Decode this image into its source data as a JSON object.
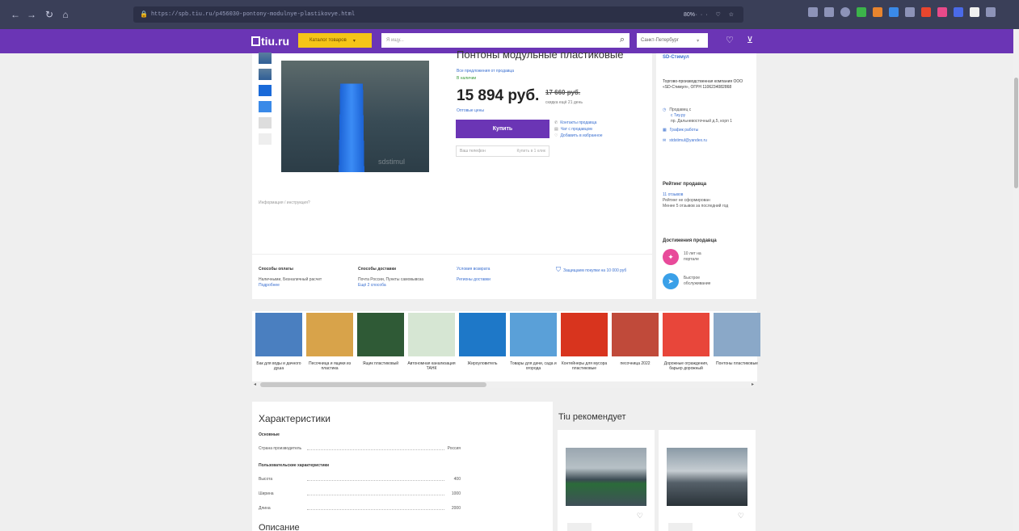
{
  "browser": {
    "url": "https://spb.tiu.ru/p456030-pontony-modulnye-plastikovye.html",
    "zoom": "80%",
    "url_actions": "··· ♡ ☆"
  },
  "header": {
    "logo": "tiu.ru",
    "catalog": "Каталог товаров",
    "search_placeholder": "Я ищу...",
    "city": "Санкт-Петербург"
  },
  "product": {
    "title": "Понтоны модульные пластиковые",
    "all_offers": "Все предложения от продавца",
    "availability": "В наличии",
    "price": "15 894 руб.",
    "old_price": "17 660 руб.",
    "old_note": "скидка ещё 21 день",
    "reviews_link": "Оптовые цены",
    "buy": "Купить",
    "phone_placeholder": "Ваш телефон",
    "callback": "Купить в 1 клик",
    "contact_seller": "Контакты продавца",
    "chat": "Чат с продавцом",
    "favorite": "Добавить в избранное",
    "instructions": "Информация / инструкция?"
  },
  "seller": {
    "name": "SD-Стимул",
    "desc": "Торгово-производственная компания ООО «SD-Стимул», ОГРН 1106234082868",
    "since_label": "Продавец с",
    "since_year": "с Тиу.ру",
    "address": "пр. Дальневосточный д.5, корп 1",
    "schedule": "График работы",
    "email": "stdstimul@yandex.ru",
    "rating_title": "Рейтинг продавца",
    "rating_link": "11 отзывов",
    "rating_line1": "Рейтинг не сформирован",
    "rating_line2": "Менее 5 отзывов за последний год",
    "ach_title": "Достижения продавца",
    "ach1": "10 лет на портале",
    "ach2": "Быстрое обслуживание"
  },
  "info_strip": {
    "payment_h": "Способы оплаты",
    "payment_text": "Наличными, Безналичный расчет",
    "payment_more": "Подробнее",
    "delivery_h": "Способы доставки",
    "delivery_text": "Почта России, Пункты самовывоза",
    "delivery_more": "Ещё 2 способа",
    "terms": "Условия возврата",
    "regions": "Регионы доставки",
    "protect": "Защищаем покупки на 10 000 руб"
  },
  "carousel": [
    {
      "label": "Бак для воды и дачного душа",
      "color": "#4a7fc0"
    },
    {
      "label": "Песочница и ящики из пластика",
      "color": "#d8a34a"
    },
    {
      "label": "Ящик пластиковый",
      "color": "#2f5a36"
    },
    {
      "label": "Автономная канализация ТАНК",
      "color": "#d6e6d3"
    },
    {
      "label": "Жироуловитель",
      "color": "#1e78c8"
    },
    {
      "label": "Товары для дачи, сада и огорода",
      "color": "#5aa0d8"
    },
    {
      "label": "Контейнеры для мусора пластиковые",
      "color": "#d8341e"
    },
    {
      "label": "песочница 2022",
      "color": "#c04a3a"
    },
    {
      "label": "Дорожные ограждения, барьер дорожный",
      "color": "#e8463a"
    },
    {
      "label": "Понтоны пластиковые",
      "color": "#8aa8c8"
    }
  ],
  "chars": {
    "title": "Характеристики",
    "group1": "Основные",
    "country_label": "Страна производитель",
    "country_value": "Россия",
    "group2": "Пользовательские характеристики",
    "height_label": "Высота",
    "height_value": "400",
    "width_label": "Ширина",
    "width_value": "1000",
    "length_label": "Длина",
    "length_value": "2000",
    "desc_title": "Описание"
  },
  "recommend": {
    "title": "Tiu рекомендует"
  },
  "colors": {
    "brand": "#6b35b5",
    "catalog": "#f5c518",
    "link": "#3a6fd0"
  }
}
